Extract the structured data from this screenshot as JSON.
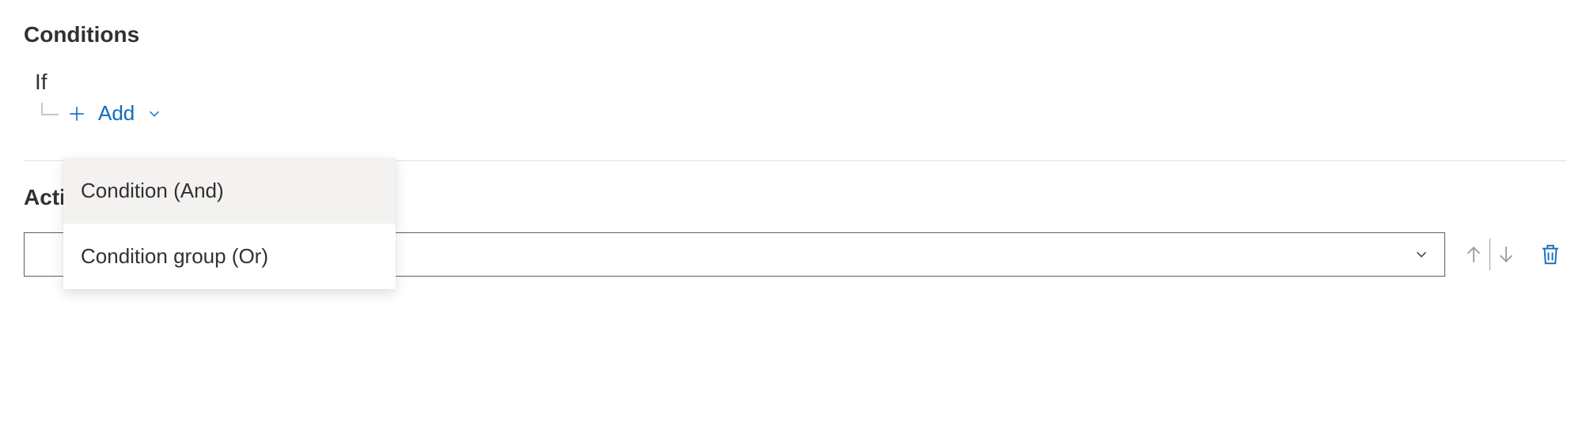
{
  "conditions": {
    "heading": "Conditions",
    "ifLabel": "If",
    "addLabel": "Add",
    "menu": {
      "item1": "Condition (And)",
      "item2": "Condition group (Or)"
    }
  },
  "actions": {
    "heading": "Actions"
  }
}
